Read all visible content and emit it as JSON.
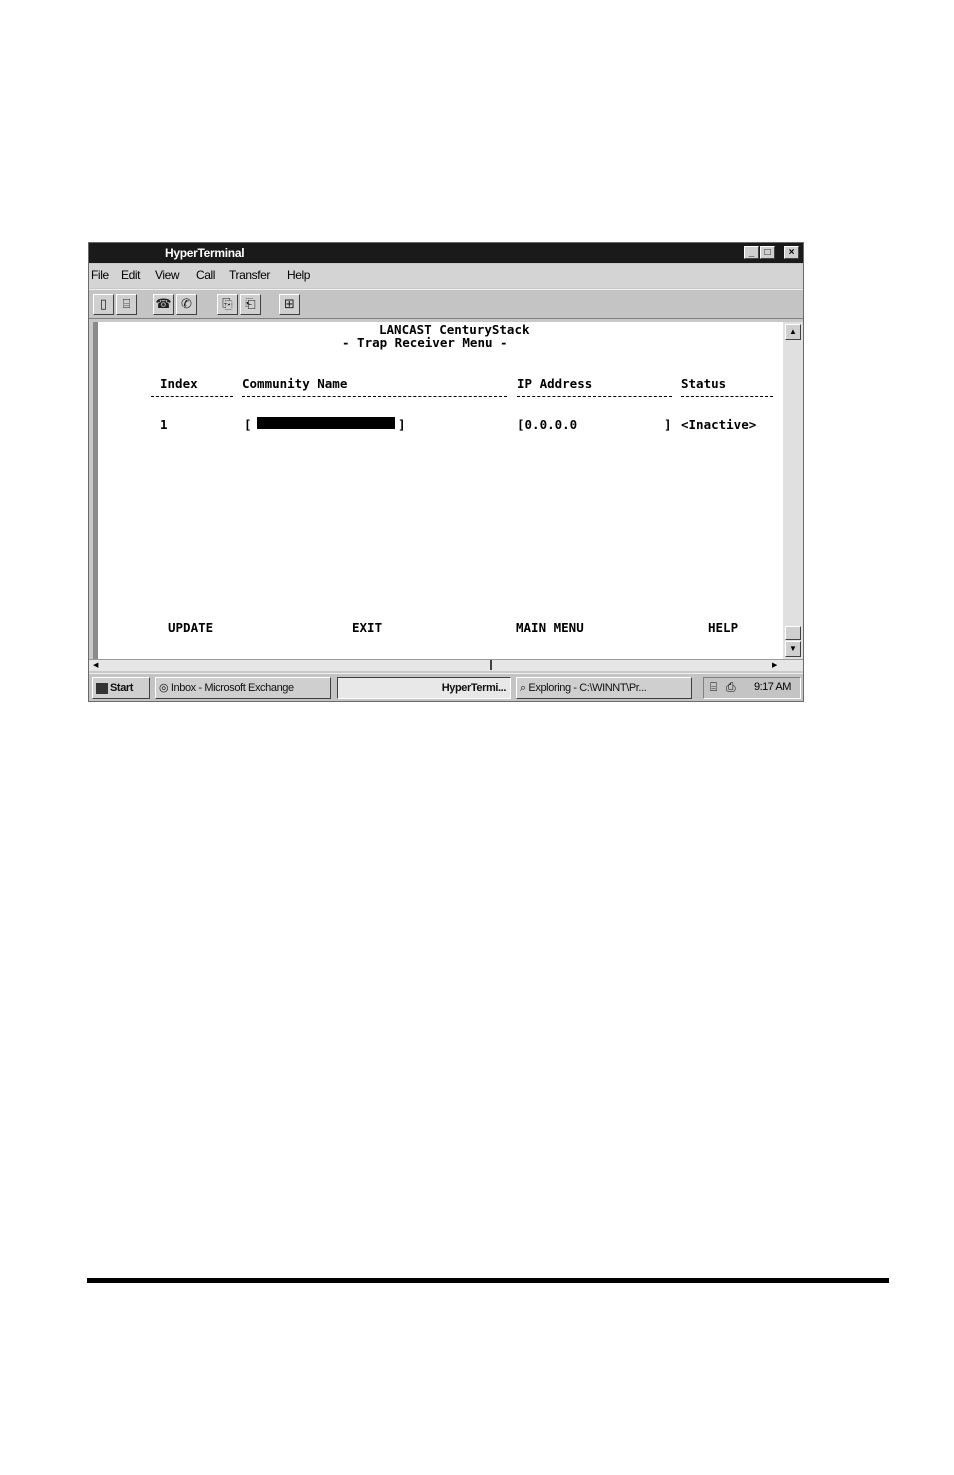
{
  "window": {
    "title": "HyperTerminal",
    "controls": {
      "minimize": "_",
      "maximize": "□",
      "close": "×"
    }
  },
  "menu": [
    "File",
    "Edit",
    "View",
    "Call",
    "Transfer",
    "Help"
  ],
  "toolbar": [
    {
      "icon": "new-icon",
      "glyph": "▯"
    },
    {
      "icon": "open-icon",
      "glyph": "⌸"
    },
    {
      "icon": "connect-icon",
      "glyph": "☎"
    },
    {
      "icon": "disconnect-icon",
      "glyph": "✆"
    },
    {
      "icon": "send-icon",
      "glyph": "⎘"
    },
    {
      "icon": "receive-icon",
      "glyph": "⎗"
    },
    {
      "icon": "properties-icon",
      "glyph": "⊞"
    }
  ],
  "terminal": {
    "heading": "LANCAST CenturyStack",
    "subheading": "- Trap Receiver Menu -",
    "columns": {
      "index": "Index",
      "community": "Community Name",
      "ip": "IP Address",
      "status": "Status"
    },
    "rows": [
      {
        "index": "1",
        "community_open": "[",
        "community_close": "]",
        "ip": "[0.0.0.0",
        "ip_close": "]",
        "status": "<Inactive>"
      }
    ],
    "commands": {
      "update": "UPDATE",
      "exit": "EXIT",
      "main_menu": "MAIN MENU",
      "help": "HELP"
    }
  },
  "taskbar": {
    "start": "Start",
    "tasks": [
      "Inbox - Microsoft Exchange",
      "HyperTermi...",
      "Exploring - C:\\WINNT\\Pr..."
    ],
    "clock": "9:17 AM"
  }
}
